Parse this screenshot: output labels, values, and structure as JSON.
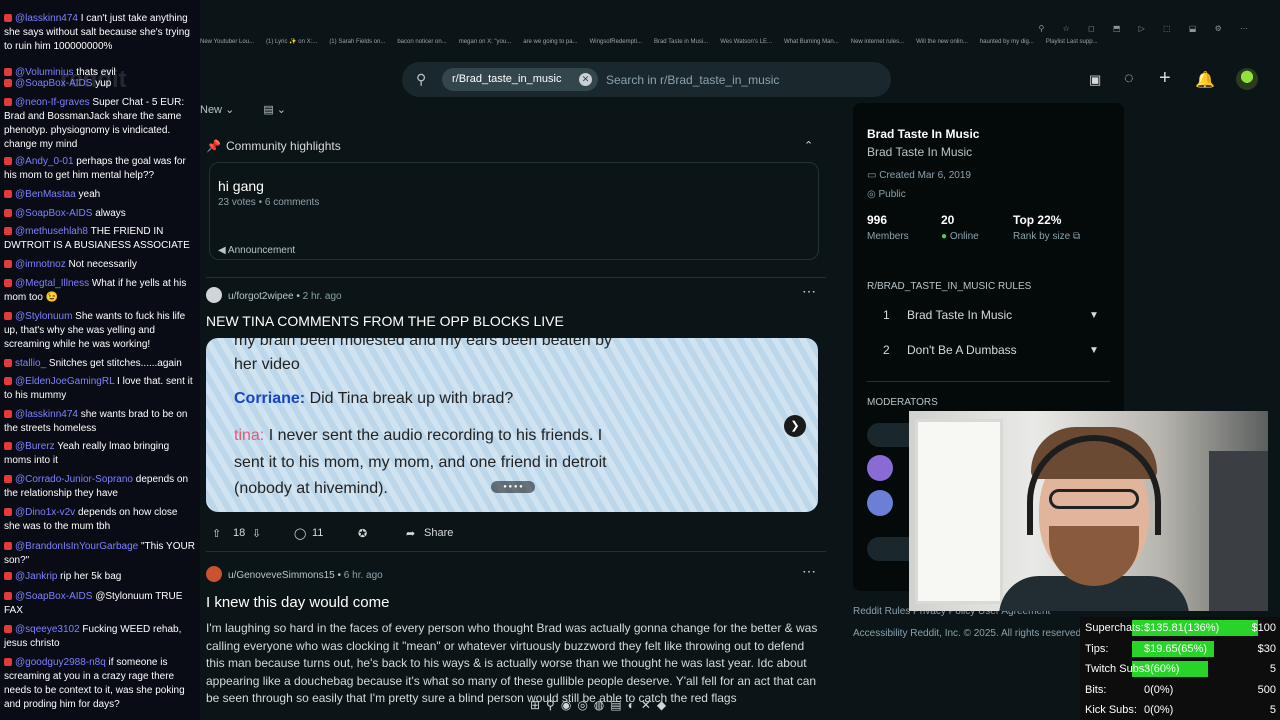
{
  "chat": {
    "messages": [
      {
        "user": "@lasskinn474",
        "text": "I can't just take anything she says without salt because she's trying to ruin him 100000000%"
      },
      {
        "user": "@Voluminius",
        "text": "thats evil"
      },
      {
        "user": "@SoapBox-AIDS",
        "text": "yup"
      },
      {
        "user": "@neon-If-graves",
        "text": "Super Chat - 5 EUR: Brad and BossmanJack share the same phenotyp. physiognomy is vindicated. change my mind"
      },
      {
        "user": "@Andy_0-01",
        "text": "perhaps the goal was for his mom to get him mental help??"
      },
      {
        "user": "@BenMastaa",
        "text": "yeah"
      },
      {
        "user": "@SoapBox-AIDS",
        "text": "always"
      },
      {
        "user": "@methusehlah8",
        "text": "THE FRIEND IN DWTROIT IS A BUSIANESS ASSOCIATE"
      },
      {
        "user": "@imnotnoz",
        "text": "Not necessarily"
      },
      {
        "user": "@Megtal_Illness",
        "text": "What if he yells at his mom too 😉"
      },
      {
        "user": "@Stylonuum",
        "text": "She wants to fuck his life up, that's why she was yelling and screaming while he was working!"
      },
      {
        "user": "stallio_",
        "text": "Snitches get stitches......again"
      },
      {
        "user": "@EldenJoeGamingRL",
        "text": "I love that. sent it to his mummy"
      },
      {
        "user": "@lasskinn474",
        "text": "she wants brad to be on the streets homeless"
      },
      {
        "user": "@Burerz",
        "text": "Yeah really lmao bringing moms into it"
      },
      {
        "user": "@Corrado-Junior-Soprano",
        "text": "depends on the relationship they have"
      },
      {
        "user": "@Dino1x-v2v",
        "text": "depends on how close she was to the mum tbh"
      },
      {
        "user": "@BrandonIsInYourGarbage",
        "text": "\"This YOUR son?\""
      },
      {
        "user": "@Jankrip",
        "text": "rip her 5k bag"
      },
      {
        "user": "@SoapBox-AIDS",
        "text": "@Stylonuum TRUE FAX"
      },
      {
        "user": "@sqeeye3102",
        "text": "Fucking WEED rehab, jesus christo"
      },
      {
        "user": "@goodguy2988-n8q",
        "text": "if someone is screaming at you in a crazy rage there needs to be context to it, was she poking and proding him for days?"
      }
    ]
  },
  "browser": {
    "tabs": [
      "New Youtuber Lou...",
      "(1) Lyric ✨ on X:...",
      "(1) Sarah Fields on...",
      "bacon noticer on...",
      "megan on X: \"you...",
      "are we going to pa...",
      "WingsofRedempti...",
      "Brad Taste in Musi...",
      "Wes Watson's LE...",
      "What Burning Man...",
      "New internet rules...",
      "Will the new onlin...",
      "haunted by my dig...",
      "Playlist Last supp..."
    ]
  },
  "header": {
    "logo": "reddit",
    "search_chip": "r/Brad_taste_in_music",
    "search_placeholder": "Search in r/Brad_taste_in_music",
    "icons": [
      "ad-icon",
      "chat-icon",
      "create-icon",
      "notification-icon",
      "avatar"
    ]
  },
  "feed": {
    "sort_label": "New",
    "highlights_title": "Community highlights",
    "highlight_card": {
      "title": "hi gang",
      "meta": "23 votes • 6 comments",
      "tag": "Announcement"
    },
    "posts": [
      {
        "author": "u/forgot2wipee",
        "time": "2 hr. ago",
        "title": "NEW TINA COMMENTS FROM THE OPP BLOCKS LIVE",
        "image_lines": [
          {
            "speaker": "",
            "text": "my brain been molested and my ears been beaten by"
          },
          {
            "speaker": "",
            "text": "her video"
          },
          {
            "speaker": "Corriane:",
            "text": " Did Tina break up with brad?"
          },
          {
            "speaker": "tina:",
            "text": " I never sent the audio recording to his friends. I"
          },
          {
            "speaker": "",
            "text": "sent it to his mom, my mom, and one friend in detroit"
          },
          {
            "speaker": "",
            "text": "(nobody at hivemind)."
          }
        ],
        "votes": "18",
        "comments": "11",
        "share": "Share"
      },
      {
        "author": "u/GenoveveSimmons15",
        "time": "6 hr. ago",
        "title": "I knew this day would come",
        "body": "I'm laughing so hard in the faces of every person who thought Brad was actually gonna change for the better & was calling everyone who was clocking it \"mean\" or whatever virtuously buzzword they felt like throwing out to defend this man because turns out, he's back to his ways & is actually worse than we thought he was last year. Idc about appearing like a douchebag because it's what so many of these gullible people deserve. Y'all fell for an act that can be seen through so easily that I'm pretty sure a blind person would still be able to catch the red flags"
      }
    ]
  },
  "sidebar": {
    "title": "Brad Taste In Music",
    "subtitle": "Brad Taste In Music",
    "created": "Created Mar 6, 2019",
    "visibility": "Public",
    "stats": [
      {
        "value": "996",
        "label": "Members"
      },
      {
        "value": "20",
        "label": "Online"
      },
      {
        "value": "Top 22%",
        "label": "Rank by size"
      }
    ],
    "rules_heading": "R/BRAD_TASTE_IN_MUSIC RULES",
    "rules": [
      {
        "num": "1",
        "text": "Brad Taste In Music"
      },
      {
        "num": "2",
        "text": "Don't Be A Dumbass"
      }
    ],
    "moderators_heading": "MODERATORS",
    "footer_links": "Reddit Rules   Privacy Policy   User Agreement",
    "footer_legal": "Accessibility   Reddit, Inc. © 2025. All rights reserved."
  },
  "donations": {
    "rows": [
      {
        "label": "Superchats:",
        "value": "$135.81(136%)",
        "goal": "$100",
        "fraction": 1.0
      },
      {
        "label": "Tips:",
        "value": "$19.65(65%)",
        "goal": "$30",
        "fraction": 0.65
      },
      {
        "label": "Twitch Subs:",
        "value": "3(60%)",
        "goal": "5",
        "fraction": 0.6
      },
      {
        "label": "Bits:",
        "value": "0(0%)",
        "goal": "500",
        "fraction": 0
      },
      {
        "label": "Kick Subs:",
        "value": "0(0%)",
        "goal": "5",
        "fraction": 0
      }
    ]
  },
  "colors": {
    "accent": "#28d428",
    "background": "#0b1416",
    "chat_user": "#7d82ff"
  }
}
